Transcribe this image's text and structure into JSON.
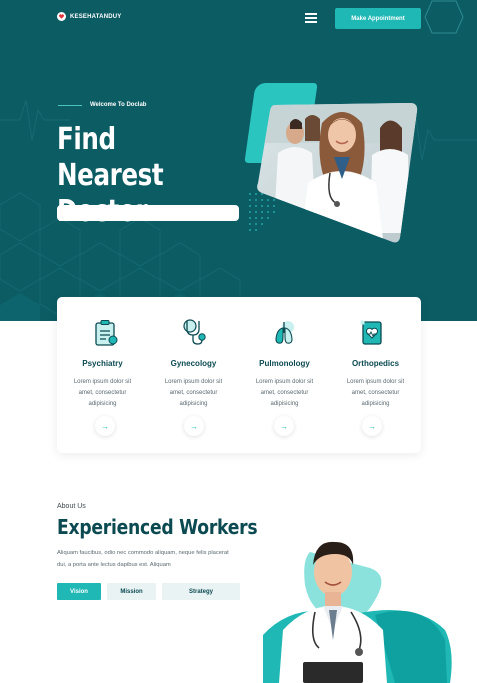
{
  "header": {
    "logo_text": "KESEHATANDUY",
    "menu_icon": "hamburger-menu-icon",
    "cta_label": "Make Appointment"
  },
  "hero": {
    "welcome": "Welcome To Doclab",
    "title_line1": "Find Nearest",
    "title_line2": "Doctor.",
    "search_placeholder": ""
  },
  "services": [
    {
      "title": "Psychiatry",
      "desc": "Lorem ipsum dolor sit amet, consectetur adipisicing",
      "icon": "clipboard-medical-icon"
    },
    {
      "title": "Gynecology",
      "desc": "Lorem ipsum dolor sit amet, consectetur adipisicing",
      "icon": "stethoscope-icon"
    },
    {
      "title": "Pulmonology",
      "desc": "Lorem ipsum dolor sit amet, consectetur adipisicing",
      "icon": "lungs-icon"
    },
    {
      "title": "Orthopedics",
      "desc": "Lorem ipsum dolor sit amet, consectetur adipisicing",
      "icon": "heart-book-icon"
    }
  ],
  "about": {
    "eyebrow": "About Us",
    "title": "Experienced Workers",
    "desc": "Aliquam faucibus, odio nec commodo aliquam, neque felis placerat dui, a porta ante lectus dapibus est. Aliquam",
    "tabs": [
      "Vision",
      "Mission",
      "Strategy"
    ]
  },
  "colors": {
    "primary_dark": "#0c5c64",
    "accent": "#1fb8b4",
    "heading": "#0c4a52"
  }
}
